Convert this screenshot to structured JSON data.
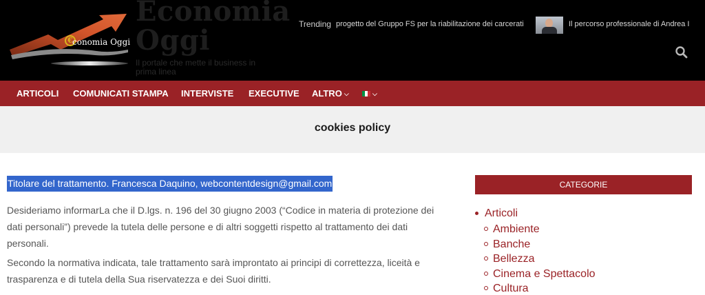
{
  "site": {
    "title_line1": "Economia",
    "title_line2": "Oggi",
    "tagline": "Il portale che mette il business in prima linea",
    "logo_text": "conomia Oggi",
    "logo_euro": "€"
  },
  "trending": {
    "label": "Trending",
    "items": [
      "progetto del Gruppo FS per la riabilitazione dei carcerati",
      "Il percorso professionale di Andrea I"
    ]
  },
  "nav": {
    "items": [
      "ARTICOLI",
      "COMUNICATI STAMPA",
      "INTERVISTE",
      "EXECUTIVE",
      "ALTRO"
    ],
    "flag_colors": [
      "#009246",
      "#ffffff",
      "#ce2b37"
    ]
  },
  "page": {
    "title": "cookies policy"
  },
  "content": {
    "highlight": "Titolare del trattamento. Francesca Daquino, webcontentdesign@gmail.com",
    "paragraph1_lines": [
      "Desideriamo informarLa che il D.lgs. n. 196 del 30 giugno 2003 (“Codice in materia di protezione dei",
      "dati personali”) prevede la tutela delle persone e di altri soggetti rispetto al trattamento dei dati",
      "personali."
    ],
    "paragraph2_lines": [
      "Secondo la normativa indicata, tale trattamento sarà improntato ai principi di correttezza, liceità e",
      "trasparenza e di tutela della Sua riservatezza e dei Suoi diritti."
    ]
  },
  "sidebar": {
    "header": "CATEGORIE",
    "top_category": "Articoli",
    "subcategories": [
      "Ambiente",
      "Banche",
      "Bellezza",
      "Cinema e Spettacolo",
      "Cultura"
    ]
  },
  "colors": {
    "brand_red": "#9a2226",
    "highlight_blue": "#3366cc"
  }
}
